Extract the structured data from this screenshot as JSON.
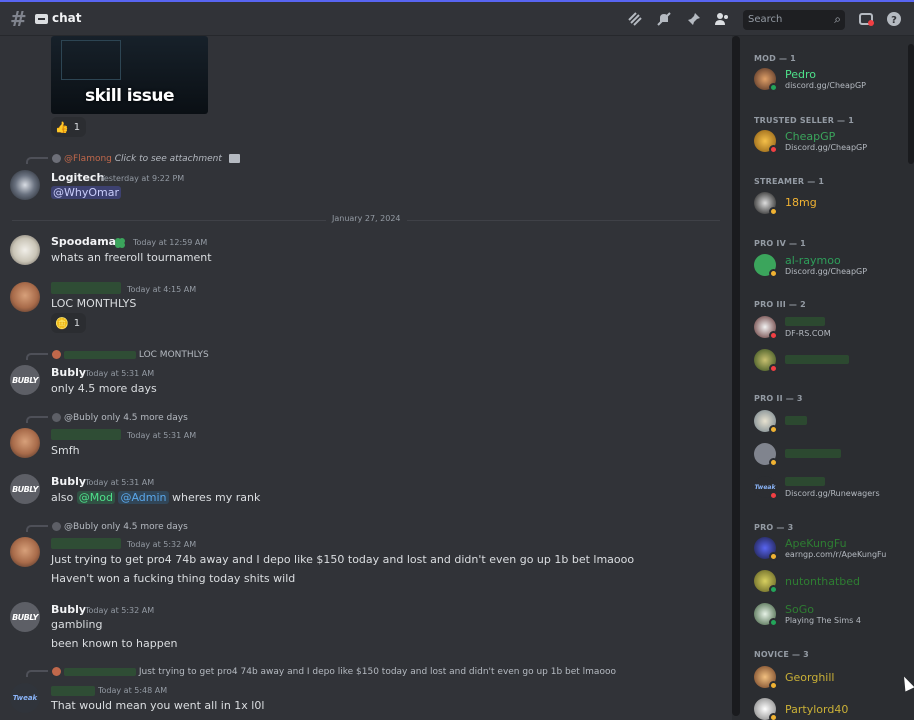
{
  "header": {
    "channel_name": "chat",
    "search_placeholder": "Search"
  },
  "messages": {
    "embed_caption": "skill issue",
    "reaction1": {
      "emoji": "👍",
      "count": "1"
    },
    "logitech": {
      "reply_to": "@Flamong",
      "reply_text": "Click to see attachment",
      "username": "Logitech",
      "timestamp": "Yesterday at 9:22 PM",
      "text": "@WhyOmar"
    },
    "date_divider": "January 27, 2024",
    "spoodaman": {
      "username": "Spoodaman",
      "timestamp": "Today at 12:59 AM",
      "text": "whats an freeroll tournament"
    },
    "m3": {
      "timestamp": "Today at 4:15 AM",
      "text": "LOC MONTHLYS",
      "reaction": {
        "emoji": "🪙",
        "count": "1"
      }
    },
    "bubly1": {
      "reply_text": "LOC MONTHLYS",
      "username": "Bubly",
      "timestamp": "Today at 5:31 AM",
      "text": "only 4.5 more days"
    },
    "m5": {
      "reply_to": "@Bubly",
      "reply_text": "only 4.5 more days",
      "timestamp": "Today at 5:31 AM",
      "text": "Smfh"
    },
    "bubly2": {
      "username": "Bubly",
      "timestamp": "Today at 5:31 AM",
      "text_prefix": "also",
      "mention1": "@Mod",
      "mention2": "@Admin",
      "text_suffix": "wheres my rank"
    },
    "m7": {
      "reply_to": "@Bubly",
      "reply_text": "only 4.5 more days",
      "timestamp": "Today at 5:32 AM",
      "line1": "Just trying to get pro4 74b away and I depo like $150 today and lost and didn't even go up 1b bet lmaooo",
      "line2": "Haven't won a fucking thing today shits wild"
    },
    "bubly3": {
      "username": "Bubly",
      "timestamp": "Today at 5:32 AM",
      "line1": "gambling",
      "line2": "been known to happen"
    },
    "m9": {
      "reply_text": "Just trying to get pro4 74b away and I depo like $150 today and lost and didn't even go up 1b bet lmaooo",
      "timestamp": "Today at 5:48 AM",
      "text": "That would mean you went all in 1x l0l"
    }
  },
  "members": {
    "mod": {
      "header": "MOD — 1",
      "name": "Pedro",
      "sub": "discord.gg/CheapGP"
    },
    "trusted": {
      "header": "TRUSTED SELLER — 1",
      "name": "CheapGP",
      "sub": "Discord.gg/CheapGP"
    },
    "streamer": {
      "header": "STREAMER — 1",
      "name": "18mg"
    },
    "pro4": {
      "header": "PRO IV — 1",
      "name": "al-raymoo",
      "sub": "Discord.gg/CheapGP"
    },
    "pro3": {
      "header": "PRO III — 2",
      "m1_sub": "DF-RS.COM"
    },
    "pro2": {
      "header": "PRO II — 3",
      "m3_sub": "Discord.gg/Runewagers"
    },
    "pro": {
      "header": "PRO — 3",
      "m1": "ApeKungFu",
      "m1_sub": "earngp.com/r/ApeKungFu",
      "m2": "nutonthatbed",
      "m3": "SoGo",
      "m3_sub": "Playing The Sims 4"
    },
    "novice": {
      "header": "NOVICE — 3",
      "m1": "Georghill",
      "m2": "Partylord40"
    }
  },
  "colors": {
    "accent": "#5865f2",
    "mod": "#4ee08a",
    "trusted": "#3ba55c",
    "streamer": "#f0b232",
    "pro": "#2e7d32",
    "novice": "#c9b037"
  }
}
